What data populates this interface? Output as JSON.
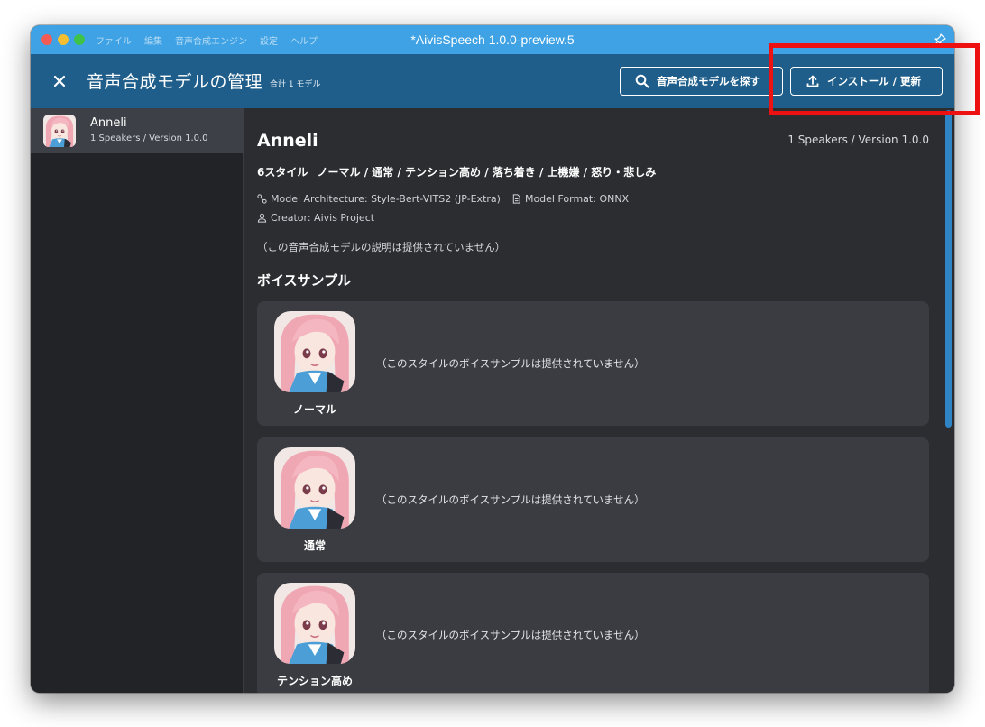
{
  "window": {
    "title": "*AivisSpeech 1.0.0-preview.5",
    "menu": [
      "ファイル",
      "編集",
      "音声合成エンジン",
      "設定",
      "ヘルプ"
    ]
  },
  "header": {
    "title": "音声合成モデルの管理",
    "count": "合計 1 モデル",
    "search_label": "音声合成モデルを探す",
    "install_label": "インストール / 更新"
  },
  "sidebar": {
    "items": [
      {
        "name": "Anneli",
        "sub": "1 Speakers / Version 1.0.0"
      }
    ]
  },
  "model": {
    "name": "Anneli",
    "meta": "1 Speakers / Version 1.0.0",
    "style_count": "6スタイル",
    "styles_list": "ノーマル / 通常 / テンション高め / 落ち着き / 上機嫌 / 怒り・悲しみ",
    "architecture": "Model Architecture: Style-Bert-VITS2 (JP-Extra)",
    "format": "Model Format: ONNX",
    "creator": "Creator: Aivis Project",
    "description": "（この音声合成モデルの説明は提供されていません）"
  },
  "samples": {
    "section_title": "ボイスサンプル",
    "cards": [
      {
        "style": "ノーマル",
        "text": "（このスタイルのボイスサンプルは提供されていません）"
      },
      {
        "style": "通常",
        "text": "（このスタイルのボイスサンプルは提供されていません）"
      },
      {
        "style": "テンション高め",
        "text": "（このスタイルのボイスサンプルは提供されていません）"
      }
    ]
  },
  "colors": {
    "titlebar": "#3fa2e4",
    "header": "#1f5e8a",
    "main_bg": "#2b2d31",
    "card_bg": "#3a3c41",
    "accent": "#2f84c6",
    "highlight": "#ee1111"
  }
}
